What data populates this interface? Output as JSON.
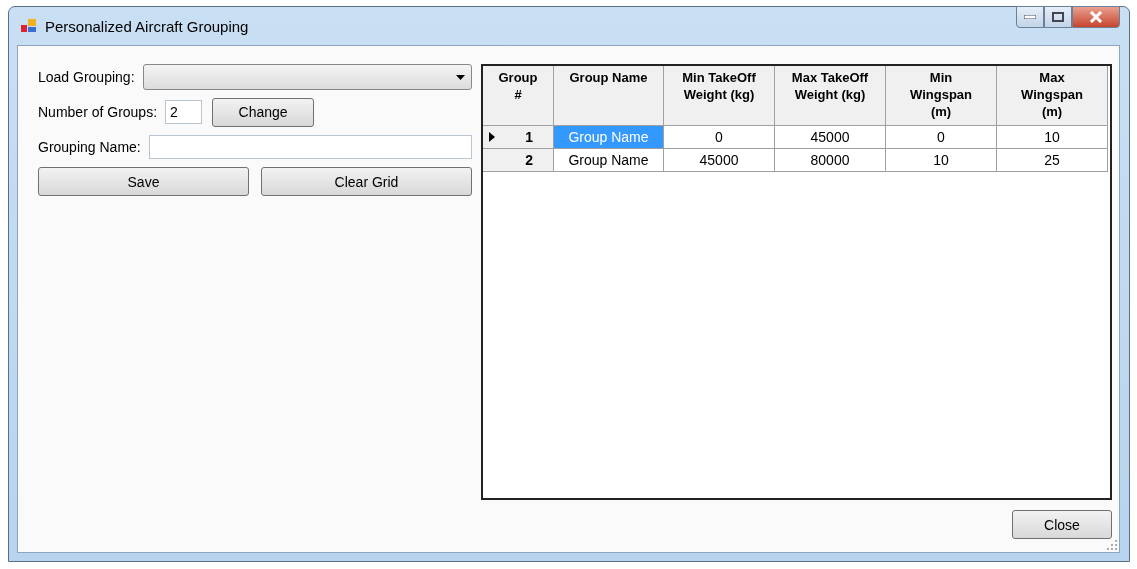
{
  "window": {
    "title": "Personalized Aircraft Grouping"
  },
  "form": {
    "load_grouping": {
      "label": "Load Grouping:"
    },
    "number_of_groups": {
      "label": "Number of Groups:",
      "value": "2",
      "button": "Change"
    },
    "grouping_name": {
      "label": "Grouping Name:"
    },
    "buttons": [
      "Save",
      "Clear Grid"
    ]
  },
  "grid": {
    "columns": [
      "Group #",
      "Group Name",
      "Min TakeOff Weight (kg)",
      "Max TakeOff Weight (kg)",
      "Min Wingspan (m)",
      "Max Wingspan (m)"
    ],
    "rows": [
      {
        "current": true,
        "cells": [
          {
            "text": "1",
            "selected": false
          },
          {
            "text": "Group Name",
            "selected": true
          },
          {
            "text": "0",
            "selected": false
          },
          {
            "text": "45000",
            "selected": false
          },
          {
            "text": "0",
            "selected": false
          },
          {
            "text": "10",
            "selected": false
          }
        ]
      },
      {
        "current": false,
        "cells": [
          {
            "text": "2",
            "selected": false
          },
          {
            "text": "Group Name",
            "selected": false
          },
          {
            "text": "45000",
            "selected": false
          },
          {
            "text": "80000",
            "selected": false
          },
          {
            "text": "10",
            "selected": false
          },
          {
            "text": "25",
            "selected": false
          }
        ]
      }
    ]
  },
  "buttons": [
    "Close"
  ]
}
